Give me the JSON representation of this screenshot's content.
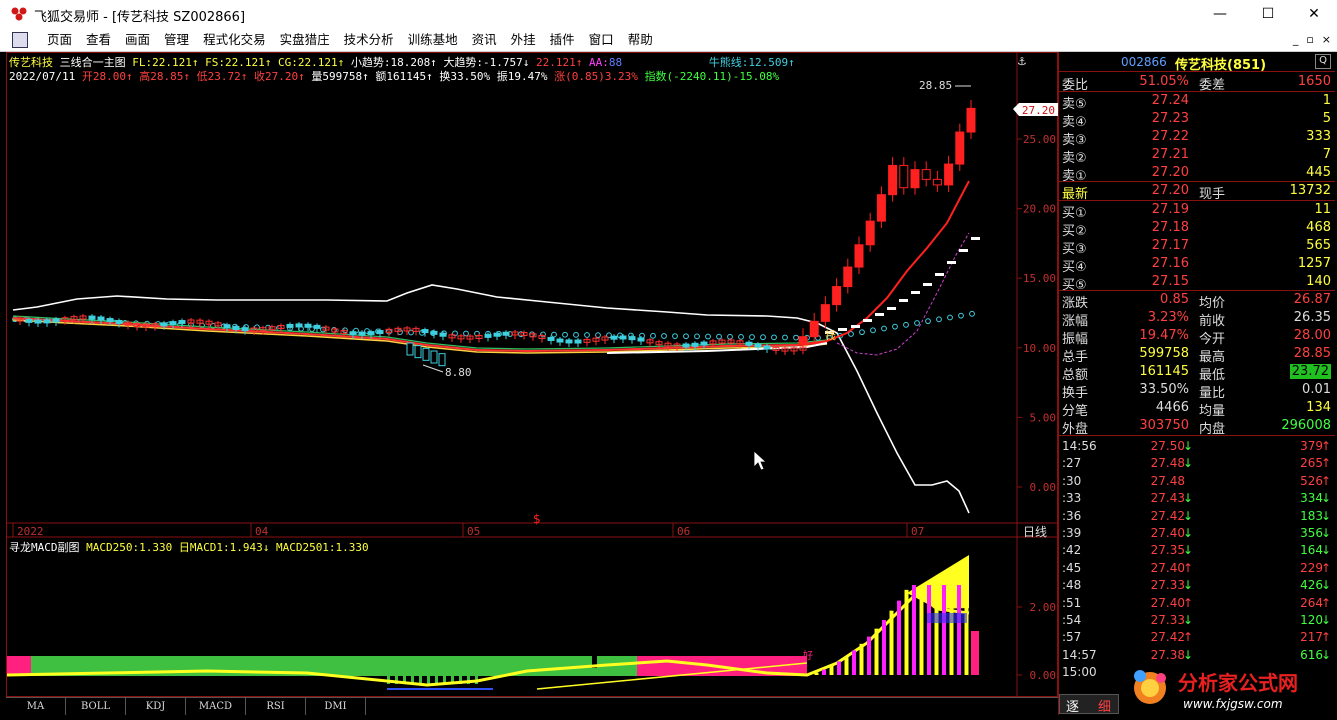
{
  "window": {
    "title": "飞狐交易师 - [传艺科技 SZ002866]",
    "min": "—",
    "max": "☐",
    "close": "✕"
  },
  "menu": [
    "页面",
    "查看",
    "画面",
    "管理",
    "程式化交易",
    "实盘猎庄",
    "技术分析",
    "训练基地",
    "资讯",
    "外挂",
    "插件",
    "窗口",
    "帮助"
  ],
  "menu_ctl": [
    "_",
    "▫",
    "×"
  ],
  "header1": {
    "name": "传艺科技",
    "chart": "三线合一主图",
    "fl": "FL:22.121↑",
    "fs": "FS:22.121↑",
    "cg": "CG:22.121↑",
    "small": "小趋势:18.208↑",
    "big": "大趋势:-1.757↓",
    "v1": "22.121↑",
    "aa": "AA:",
    "aav": "88",
    "bull": "牛熊线:12.509↑"
  },
  "header2": {
    "date": "2022/07/11",
    "open": "开28.00↑",
    "high": "高28.85↑",
    "low": "低23.72↑",
    "close": "收27.20↑",
    "vol": "量599758↑",
    "amt": "额161145↑",
    "turn": "换33.50%",
    "amp": "振19.47%",
    "chg": "涨(0.85)3.23%",
    "idx": "指数(-2240.11)-15.08%"
  },
  "sub_header": {
    "name": "寻龙MACD副图",
    "m1": "MACD250:1.330",
    "m2": "日MACD1:1.943↓",
    "m3": "MACD2501:1.330"
  },
  "chart_labels": {
    "high_label": "28.85",
    "low_label": "8.80",
    "price_tag": "27.20",
    "period": "日线",
    "xticks": [
      "2022",
      "04",
      "05",
      "06",
      "07"
    ],
    "yticks": [
      "25.00",
      "20.00",
      "15.00",
      "10.00",
      "5.00",
      "0.00"
    ],
    "sub_yticks": [
      "2.00",
      "0.00"
    ],
    "buy_mark": "钱",
    "money_mark": "$",
    "good_mark": "好"
  },
  "chart_data": {
    "type": "candlestick",
    "yrange": [
      0,
      30
    ],
    "recent_closes": [
      10.8,
      11.9,
      13.1,
      14.4,
      15.8,
      17.4,
      19.1,
      21.0,
      23.1,
      21.5,
      22.8,
      22.1,
      21.7,
      23.2,
      25.5,
      27.2
    ]
  },
  "quote": {
    "code": "002866",
    "name": "传艺科技(851)",
    "corner": "Q",
    "webi": {
      "l1": "委比",
      "v1": "51.05%",
      "l2": "委差",
      "v2": "1650"
    },
    "sells": [
      {
        "l": "卖⑤",
        "p": "27.24",
        "v": "1"
      },
      {
        "l": "卖④",
        "p": "27.23",
        "v": "5"
      },
      {
        "l": "卖③",
        "p": "27.22",
        "v": "333"
      },
      {
        "l": "卖②",
        "p": "27.21",
        "v": "7"
      },
      {
        "l": "卖①",
        "p": "27.20",
        "v": "445"
      }
    ],
    "latest": {
      "l": "最新",
      "p": "27.20",
      "l2": "现手",
      "v": "13732"
    },
    "buys": [
      {
        "l": "买①",
        "p": "27.19",
        "v": "11"
      },
      {
        "l": "买②",
        "p": "27.18",
        "v": "468"
      },
      {
        "l": "买③",
        "p": "27.17",
        "v": "565"
      },
      {
        "l": "买④",
        "p": "27.16",
        "v": "1257"
      },
      {
        "l": "买⑤",
        "p": "27.15",
        "v": "140"
      }
    ],
    "stats": [
      {
        "l1": "涨跌",
        "v1": "0.85",
        "l2": "均价",
        "v2": "26.87"
      },
      {
        "l1": "涨幅",
        "v1": "3.23%",
        "l2": "前收",
        "v2": "26.35"
      },
      {
        "l1": "振幅",
        "v1": "19.47%",
        "l2": "今开",
        "v2": "28.00"
      },
      {
        "l1": "总手",
        "v1": "599758",
        "l2": "最高",
        "v2": "28.85"
      },
      {
        "l1": "总额",
        "v1": "161145",
        "l2": "最低",
        "v2": "23.72"
      },
      {
        "l1": "换手",
        "v1": "33.50%",
        "l2": "量比",
        "v2": "0.01"
      },
      {
        "l1": "分笔",
        "v1": "4466",
        "l2": "均量",
        "v2": "134"
      },
      {
        "l1": "外盘",
        "v1": "303750",
        "l2": "内盘",
        "v2": "296008"
      }
    ],
    "ticks": [
      {
        "t": "14:56",
        "p": "27.50",
        "a": "↓",
        "v": "379",
        "a2": "↑"
      },
      {
        "t": ":27",
        "p": "27.48",
        "a": "↓",
        "v": "265",
        "a2": "↑"
      },
      {
        "t": ":30",
        "p": "27.48",
        "a": "",
        "v": "526",
        "a2": "↑"
      },
      {
        "t": ":33",
        "p": "27.43",
        "a": "↓",
        "v": "334",
        "a2": "↓"
      },
      {
        "t": ":36",
        "p": "27.42",
        "a": "↓",
        "v": "183",
        "a2": "↓"
      },
      {
        "t": ":39",
        "p": "27.40",
        "a": "↓",
        "v": "356",
        "a2": "↓"
      },
      {
        "t": ":42",
        "p": "27.35",
        "a": "↓",
        "v": "164",
        "a2": "↓"
      },
      {
        "t": ":45",
        "p": "27.40",
        "a": "↑",
        "v": "229",
        "a2": "↑"
      },
      {
        "t": ":48",
        "p": "27.33",
        "a": "↓",
        "v": "426",
        "a2": "↓"
      },
      {
        "t": ":51",
        "p": "27.40",
        "a": "↑",
        "v": "264",
        "a2": "↑"
      },
      {
        "t": ":54",
        "p": "27.33",
        "a": "↓",
        "v": "120",
        "a2": "↓"
      },
      {
        "t": ":57",
        "p": "27.42",
        "a": "↑",
        "v": "217",
        "a2": "↑"
      },
      {
        "t": "14:57",
        "p": "27.38",
        "a": "↓",
        "v": "616",
        "a2": "↓"
      },
      {
        "t": "15:00",
        "p": "",
        "a": "",
        "v": "",
        "a2": ""
      }
    ],
    "tab": "逐",
    "tab2": "细"
  },
  "bottom_tabs": [
    "MA",
    "BOLL",
    "KDJ",
    "MACD",
    "RSI",
    "DMI"
  ],
  "watermark": {
    "text": "分析家公式网",
    "url": "www.fxjgsw.com"
  }
}
